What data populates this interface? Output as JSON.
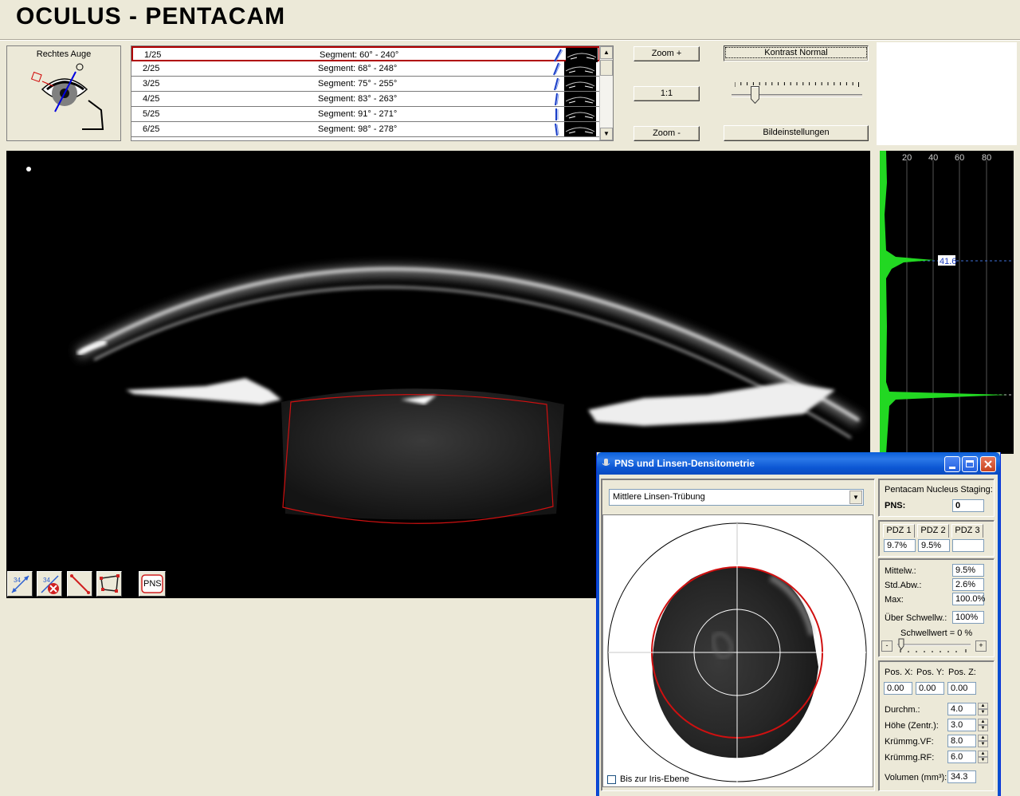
{
  "app": {
    "title": "OCULUS  -  PENTACAM"
  },
  "eye_panel": {
    "label": "Rechtes Auge"
  },
  "segments": [
    {
      "index": "1/25",
      "segment": "Segment: 60° - 240°"
    },
    {
      "index": "2/25",
      "segment": "Segment: 68° - 248°"
    },
    {
      "index": "3/25",
      "segment": "Segment: 75° - 255°"
    },
    {
      "index": "4/25",
      "segment": "Segment: 83° - 263°"
    },
    {
      "index": "5/25",
      "segment": "Segment: 91° - 271°"
    },
    {
      "index": "6/25",
      "segment": "Segment: 98° - 278°"
    }
  ],
  "toolbar": {
    "zoom_in": "Zoom +",
    "zoom_reset": "1:1",
    "zoom_out": "Zoom -",
    "contrast": "Kontrast Normal",
    "image_settings": "Bildeinstellungen"
  },
  "contrast_slider": {
    "level": 0.15
  },
  "image_tools": {
    "pns_label": "PNS"
  },
  "density_graph": {
    "ticks": [
      "20",
      "40",
      "60",
      "80"
    ],
    "peak_label": "41.6",
    "color": "#22d822"
  },
  "dialog": {
    "title": "PNS und Linsen-Densitometrie",
    "mode": "Mittlere Linsen-Trübung",
    "iris_plane_label": "Bis zur Iris-Ebene",
    "staging": {
      "header": "Pentacam Nucleus Staging:",
      "pns_label": "PNS:",
      "pns_value": "0"
    },
    "pdz": {
      "headers": [
        "PDZ 1",
        "PDZ 2",
        "PDZ 3"
      ],
      "values": [
        "9.7%",
        "9.5%",
        ""
      ]
    },
    "stats": {
      "mean_label": "Mittelw.:",
      "mean": "9.5%",
      "std_label": "Std.Abw.:",
      "std": "2.6%",
      "max_label": "Max:",
      "max": "100.0%",
      "above_label": "Über Schwellw.:",
      "above": "100%",
      "threshold_label": "Schwellwert = 0 %",
      "minus": "-",
      "plus": "+"
    },
    "position": {
      "x_label": "Pos. X:",
      "x": "0.00",
      "y_label": "Pos. Y:",
      "y": "0.00",
      "z_label": "Pos. Z:",
      "z": "0.00"
    },
    "geometry": {
      "diam_label": "Durchm.:",
      "diam": "4.0",
      "height_label": "Höhe (Zentr.):",
      "height": "3.0",
      "curv_front_label": "Krümmg.VF:",
      "curv_front": "8.0",
      "curv_back_label": "Krümmg.RF:",
      "curv_back": "6.0",
      "volume_label": "Volumen (mm³):",
      "volume": "34.3"
    }
  },
  "colors": {
    "selection": "#b00000",
    "roi": "#d01010",
    "titlebar": "#0a5fd8"
  }
}
